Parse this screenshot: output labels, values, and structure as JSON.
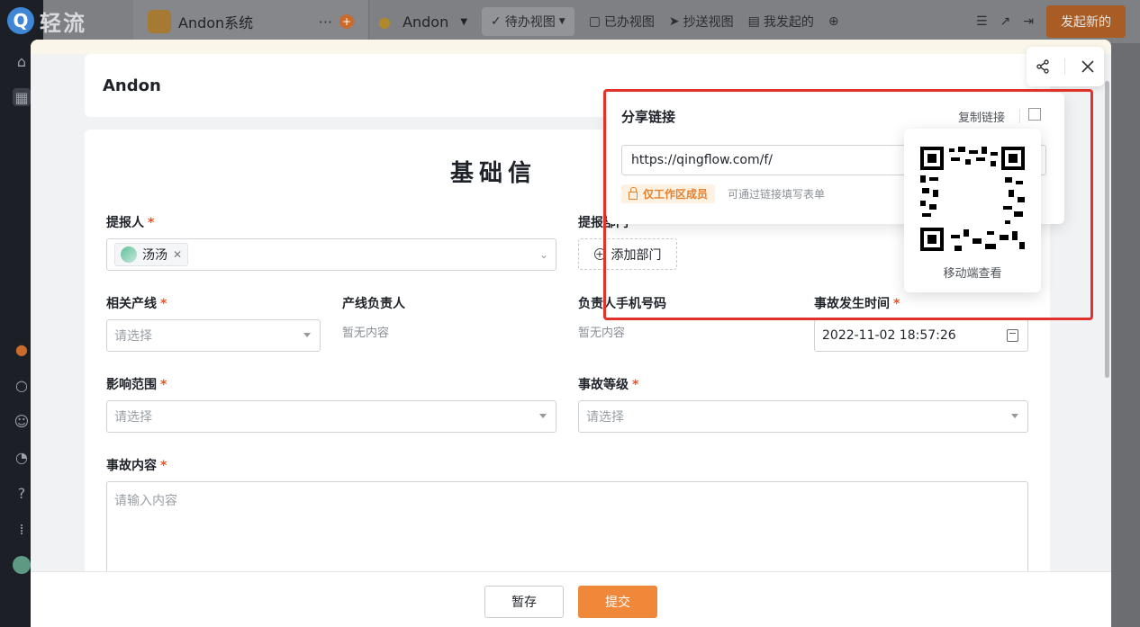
{
  "header": {
    "logo_text": "轻流",
    "logo_letter": "Q",
    "app_name": "Andon系统",
    "app_more": "···",
    "tabs": {
      "app_label": "Andon",
      "todo": "待办视图",
      "done": "已办视图",
      "cc": "抄送视图",
      "mine": "我发起的"
    },
    "launch_button": "发起新的"
  },
  "modal": {
    "title": "Andon",
    "section_title": "基础信",
    "fields": {
      "reporter": {
        "label": "提报人",
        "chip": "汤汤"
      },
      "reporter_dept": {
        "label": "提报部门",
        "add_button": "添加部门"
      },
      "line": {
        "label": "相关产线",
        "placeholder": "请选择"
      },
      "line_owner": {
        "label": "产线负责人",
        "value": "暂无内容"
      },
      "owner_phone": {
        "label": "负责人手机号码",
        "value": "暂无内容"
      },
      "incident_time": {
        "label": "事故发生时间",
        "value": "2022-11-02 18:57:26"
      },
      "scope": {
        "label": "影响范围",
        "placeholder": "请选择"
      },
      "level": {
        "label": "事故等级",
        "placeholder": "请选择"
      },
      "content": {
        "label": "事故内容",
        "placeholder": "请输入内容"
      }
    },
    "required_mark": "*",
    "footer": {
      "draft": "暂存",
      "submit": "提交"
    }
  },
  "share": {
    "title": "分享链接",
    "copy_link": "复制链接",
    "url": "https://qingflow.com/f/",
    "badge": "仅工作区成员",
    "hint": "可通过链接填写表单",
    "qr_caption": "移动端查看"
  },
  "colors": {
    "accent": "#f0883a",
    "highlight": "#e0312b",
    "required": "#e8541e"
  }
}
